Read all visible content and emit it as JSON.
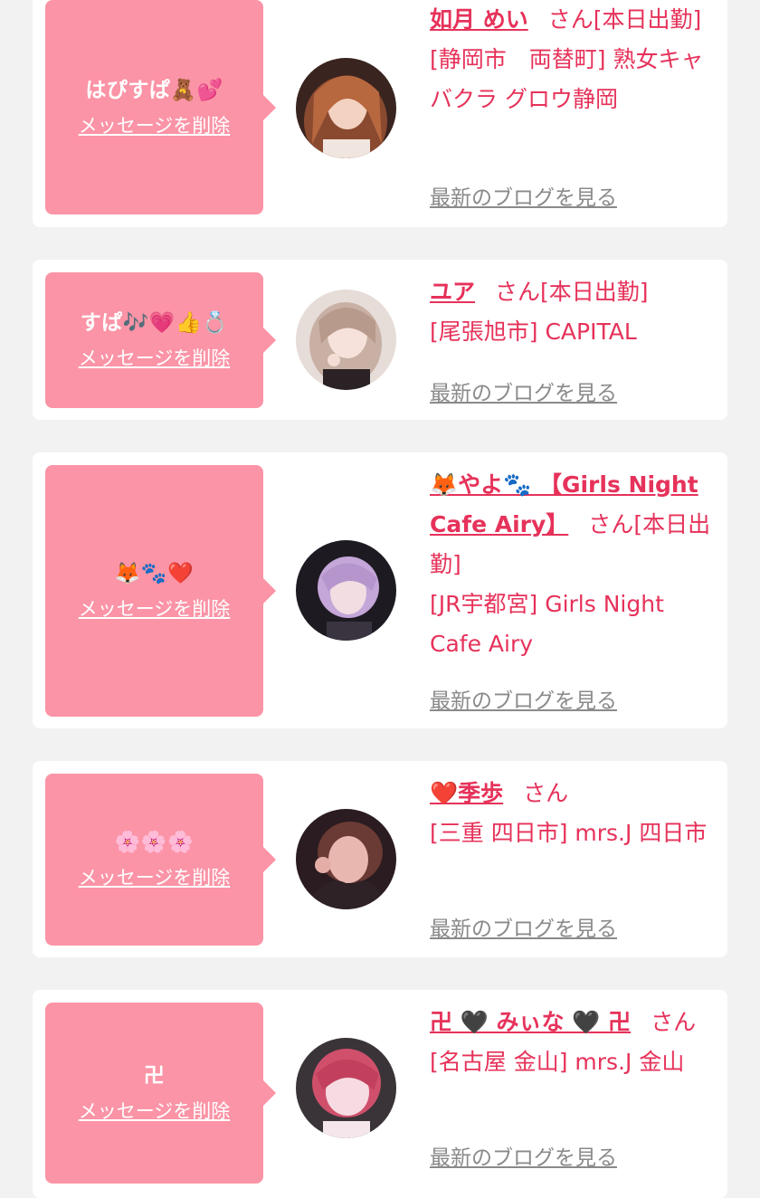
{
  "delete_label": "メッセージを削除",
  "blog_label": "最新のブログを見る",
  "honorific": "さん",
  "accent_color": "#e6325a",
  "bubble_color": "#fb94a6",
  "cards": [
    {
      "message": "はぴすぱ🧸💕",
      "name": "如月 めい",
      "status": "[本日出勤]",
      "shop": "[静岡市　両替町] 熟女キャバクラ グロウ静岡"
    },
    {
      "message": "すぱ🎶💗👍💍",
      "name": "ユア",
      "status": "[本日出勤]",
      "shop": "[尾張旭市] CAPITAL"
    },
    {
      "message": "🦊🐾❤️",
      "name": "🦊やよ🐾 【Girls Night Cafe Airy】",
      "status": "[本日出勤]",
      "shop": "[JR宇都宮] Girls Night Cafe Airy"
    },
    {
      "message": "🌸🌸🌸",
      "name": "❤️季歩",
      "status": "",
      "shop": "[三重 四日市] mrs.J 四日市"
    },
    {
      "message": "卍",
      "name": "卍 🖤 みぃな 🖤 卍",
      "status": "",
      "shop": "[名古屋 金山] mrs.J 金山"
    }
  ]
}
